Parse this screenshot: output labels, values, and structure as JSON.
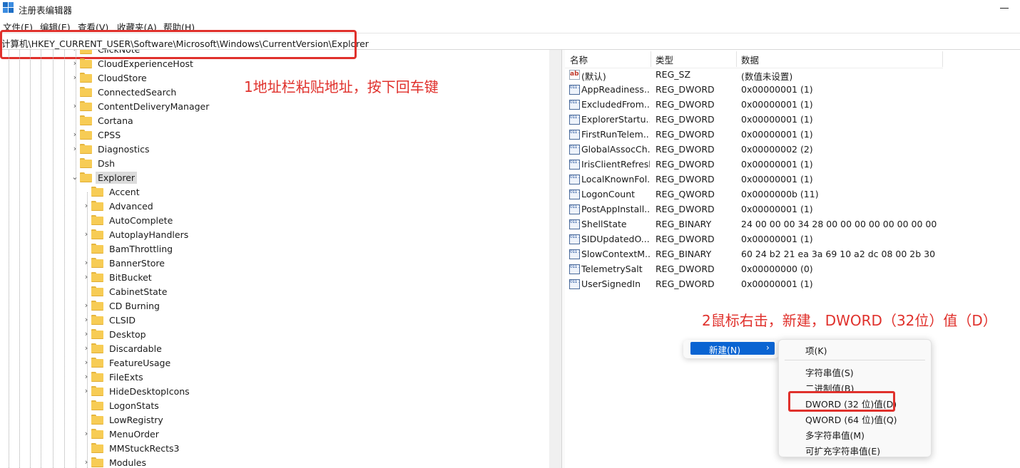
{
  "window": {
    "title": "注册表编辑器",
    "menu": [
      "文件(F)",
      "编辑(E)",
      "查看(V)",
      "收藏夹(A)",
      "帮助(H)"
    ]
  },
  "address_bar": {
    "path": "计算机\\HKEY_CURRENT_USER\\Software\\Microsoft\\Windows\\CurrentVersion\\Explorer"
  },
  "tree": {
    "items": [
      {
        "label": "ClickNote",
        "expander": "›"
      },
      {
        "label": "CloudExperienceHost",
        "expander": "›"
      },
      {
        "label": "CloudStore",
        "expander": "›"
      },
      {
        "label": "ConnectedSearch",
        "expander": ""
      },
      {
        "label": "ContentDeliveryManager",
        "expander": "›"
      },
      {
        "label": "Cortana",
        "expander": ""
      },
      {
        "label": "CPSS",
        "expander": "›"
      },
      {
        "label": "Diagnostics",
        "expander": "›"
      },
      {
        "label": "Dsh",
        "expander": ""
      },
      {
        "label": "Explorer",
        "expander": "⌄"
      },
      {
        "label": "Accent",
        "expander": ""
      },
      {
        "label": "Advanced",
        "expander": "›"
      },
      {
        "label": "AutoComplete",
        "expander": ""
      },
      {
        "label": "AutoplayHandlers",
        "expander": "›"
      },
      {
        "label": "BamThrottling",
        "expander": ""
      },
      {
        "label": "BannerStore",
        "expander": "›"
      },
      {
        "label": "BitBucket",
        "expander": "›"
      },
      {
        "label": "CabinetState",
        "expander": ""
      },
      {
        "label": "CD Burning",
        "expander": "›"
      },
      {
        "label": "CLSID",
        "expander": "›"
      },
      {
        "label": "Desktop",
        "expander": "›"
      },
      {
        "label": "Discardable",
        "expander": "›"
      },
      {
        "label": "FeatureUsage",
        "expander": "›"
      },
      {
        "label": "FileExts",
        "expander": "›"
      },
      {
        "label": "HideDesktopIcons",
        "expander": "›"
      },
      {
        "label": "LogonStats",
        "expander": ""
      },
      {
        "label": "LowRegistry",
        "expander": ""
      },
      {
        "label": "MenuOrder",
        "expander": "›"
      },
      {
        "label": "MMStuckRects3",
        "expander": ""
      },
      {
        "label": "Modules",
        "expander": "›"
      }
    ]
  },
  "values": {
    "columns": {
      "name": "名称",
      "type": "类型",
      "data": "数据"
    },
    "rows": [
      {
        "name": "(默认)",
        "type": "REG_SZ",
        "data": "(数值未设置)",
        "icon": "string-value-icon"
      },
      {
        "name": "AppReadiness...",
        "type": "REG_DWORD",
        "data": "0x00000001 (1)",
        "icon": "binary-value-icon"
      },
      {
        "name": "ExcludedFrom...",
        "type": "REG_DWORD",
        "data": "0x00000001 (1)",
        "icon": "binary-value-icon"
      },
      {
        "name": "ExplorerStartu...",
        "type": "REG_DWORD",
        "data": "0x00000001 (1)",
        "icon": "binary-value-icon"
      },
      {
        "name": "FirstRunTelem...",
        "type": "REG_DWORD",
        "data": "0x00000001 (1)",
        "icon": "binary-value-icon"
      },
      {
        "name": "GlobalAssocCh...",
        "type": "REG_DWORD",
        "data": "0x00000002 (2)",
        "icon": "binary-value-icon"
      },
      {
        "name": "IrisClientRefresh",
        "type": "REG_DWORD",
        "data": "0x00000001 (1)",
        "icon": "binary-value-icon"
      },
      {
        "name": "LocalKnownFol...",
        "type": "REG_DWORD",
        "data": "0x00000001 (1)",
        "icon": "binary-value-icon"
      },
      {
        "name": "LogonCount",
        "type": "REG_QWORD",
        "data": "0x0000000b (11)",
        "icon": "binary-value-icon"
      },
      {
        "name": "PostAppInstall...",
        "type": "REG_DWORD",
        "data": "0x00000001 (1)",
        "icon": "binary-value-icon"
      },
      {
        "name": "ShellState",
        "type": "REG_BINARY",
        "data": "24 00 00 00 34 28 00 00 00 00 00 00 00 00 00...",
        "icon": "binary-value-icon"
      },
      {
        "name": "SIDUpdatedO...",
        "type": "REG_DWORD",
        "data": "0x00000001 (1)",
        "icon": "binary-value-icon"
      },
      {
        "name": "SlowContextM...",
        "type": "REG_BINARY",
        "data": "60 24 b2 21 ea 3a 69 10 a2 dc 08 00 2b 30 3...",
        "icon": "binary-value-icon"
      },
      {
        "name": "TelemetrySalt",
        "type": "REG_DWORD",
        "data": "0x00000000 (0)",
        "icon": "binary-value-icon"
      },
      {
        "name": "UserSignedIn",
        "type": "REG_DWORD",
        "data": "0x00000001 (1)",
        "icon": "binary-value-icon"
      }
    ]
  },
  "context_menu": {
    "new_label": "新建(N)",
    "new_arrow": "›",
    "submenu": [
      {
        "label": "项(K)"
      },
      {
        "label": "字符串值(S)"
      },
      {
        "label": "二进制值(B)"
      },
      {
        "label": "DWORD (32 位)值(D)"
      },
      {
        "label": "QWORD (64 位)值(Q)"
      },
      {
        "label": "多字符串值(M)"
      },
      {
        "label": "可扩充字符串值(E)"
      }
    ]
  },
  "annotations": {
    "step1": "1地址栏粘贴地址，按下回车键",
    "step2": "2鼠标右击，新建，DWORD（32位）值（D）"
  },
  "colors": {
    "annotation": "#e0312c",
    "menu_highlight": "#0a64d2",
    "folder": "#f7cc55"
  }
}
